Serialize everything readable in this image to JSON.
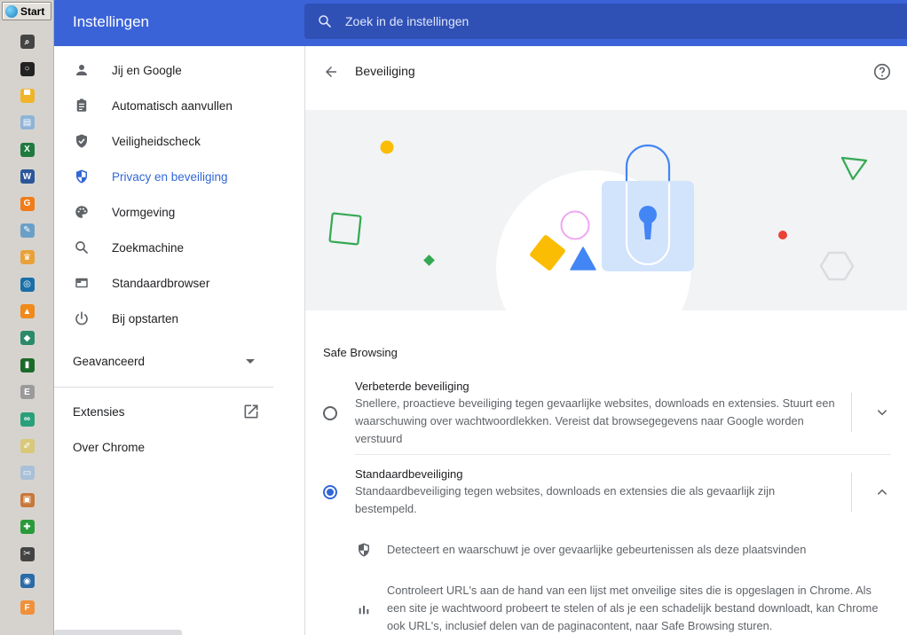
{
  "taskbar": {
    "start_label": "Start",
    "icons": [
      {
        "name": "search-icon",
        "color": "#444444",
        "glyph": "⌕"
      },
      {
        "name": "cortana-icon",
        "color": "#222222",
        "glyph": "○"
      },
      {
        "name": "file-explorer-icon",
        "color": "#f0b428",
        "glyph": "▀"
      },
      {
        "name": "notepad-icon",
        "color": "#8fb4d8",
        "glyph": "▤"
      },
      {
        "name": "excel-icon",
        "color": "#1f7a3f",
        "glyph": "X"
      },
      {
        "name": "word-icon",
        "color": "#2b579a",
        "glyph": "W"
      },
      {
        "name": "app-orange-icon",
        "color": "#f07c1a",
        "glyph": "G"
      },
      {
        "name": "paint-icon",
        "color": "#6aa0c8",
        "glyph": "✎"
      },
      {
        "name": "app-crown-icon",
        "color": "#e8a23a",
        "glyph": "♛"
      },
      {
        "name": "media-disc-icon",
        "color": "#1a6fa8",
        "glyph": "◎"
      },
      {
        "name": "vlc-icon",
        "color": "#f08a1a",
        "glyph": "▲"
      },
      {
        "name": "app-diamond-icon",
        "color": "#2a8a6a",
        "glyph": "◆"
      },
      {
        "name": "audio-meter-icon",
        "color": "#1a6a2a",
        "glyph": "▮"
      },
      {
        "name": "eac-icon",
        "color": "#9a9a9a",
        "glyph": "E"
      },
      {
        "name": "tripadvisor-icon",
        "color": "#2aa07a",
        "glyph": "∞"
      },
      {
        "name": "notes-icon",
        "color": "#d8c878",
        "glyph": "✐"
      },
      {
        "name": "document-icon",
        "color": "#a8c0d8",
        "glyph": "▭"
      },
      {
        "name": "image-app-icon",
        "color": "#c8783a",
        "glyph": "▣"
      },
      {
        "name": "green-app-icon",
        "color": "#2a9a3a",
        "glyph": "✚"
      },
      {
        "name": "tool-icon",
        "color": "#444444",
        "glyph": "✂"
      },
      {
        "name": "calendar-2014-icon",
        "color": "#2a6aa8",
        "glyph": "◉"
      },
      {
        "name": "app-f-icon",
        "color": "#f0903a",
        "glyph": "F"
      }
    ]
  },
  "header": {
    "title": "Instellingen",
    "search_placeholder": "Zoek in de instellingen"
  },
  "sidebar": {
    "items": [
      {
        "label": "Jij en Google",
        "icon": "person-icon",
        "active": false
      },
      {
        "label": "Automatisch aanvullen",
        "icon": "clipboard-icon",
        "active": false
      },
      {
        "label": "Veiligheidscheck",
        "icon": "shield-check-icon",
        "active": false
      },
      {
        "label": "Privacy en beveiliging",
        "icon": "shield-half-icon",
        "active": true
      },
      {
        "label": "Vormgeving",
        "icon": "palette-icon",
        "active": false
      },
      {
        "label": "Zoekmachine",
        "icon": "search-icon",
        "active": false
      },
      {
        "label": "Standaardbrowser",
        "icon": "browser-icon",
        "active": false
      },
      {
        "label": "Bij opstarten",
        "icon": "power-icon",
        "active": false
      }
    ],
    "advanced_label": "Geavanceerd",
    "extensions_label": "Extensies",
    "about_label": "Over Chrome"
  },
  "main": {
    "page_title": "Beveiliging",
    "section_title": "Safe Browsing",
    "options": [
      {
        "title": "Verbeterde beveiliging",
        "description": "Snellere, proactieve beveiliging tegen gevaarlijke websites, downloads en extensies. Stuurt een waarschuwing over wachtwoordlekken. Vereist dat browsegegevens naar Google worden verstuurd",
        "checked": false
      },
      {
        "title": "Standaardbeveiliging",
        "description": "Standaardbeveiliging tegen websites, downloads en extensies die als gevaarlijk zijn bestempeld.",
        "checked": true
      }
    ],
    "details": [
      {
        "icon": "shield-outline-icon",
        "text": "Detecteert en waarschuwt je over gevaarlijke gebeurtenissen als deze plaatsvinden"
      },
      {
        "icon": "bar-chart-icon",
        "text": "Controleert URL's aan de hand van een lijst met onveilige sites die is opgeslagen in Chrome. Als een site je wachtwoord probeert te stelen of als je een schadelijk bestand downloadt, kan Chrome ook URL's, inclusief delen van de paginacontent, naar Safe Browsing sturen."
      }
    ]
  },
  "colors": {
    "header_bg": "#3b63d8",
    "search_bg": "#2f50b5",
    "accent": "#3367d6",
    "banner_bg": "#f1f3f4"
  }
}
